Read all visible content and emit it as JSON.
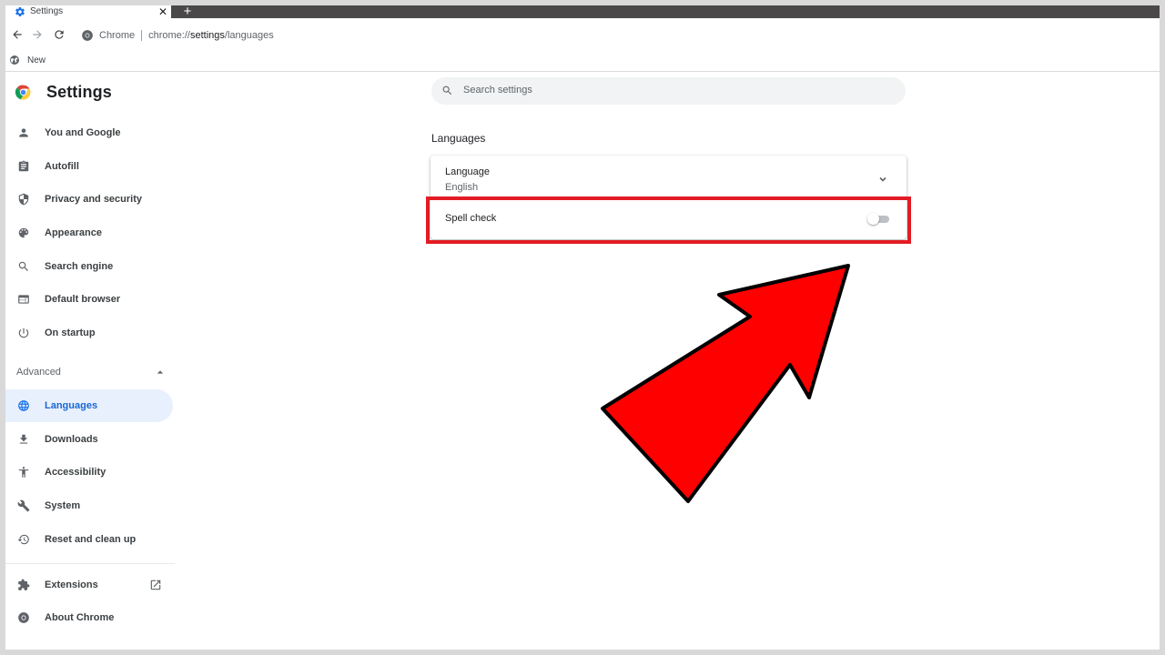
{
  "browser": {
    "tab_title": "Settings",
    "omnibox_chip": "Chrome",
    "url_scheme": "chrome://",
    "url_host": "settings",
    "url_path": "/languages",
    "bookmark_label": "New"
  },
  "sidebar": {
    "title": "Settings",
    "items": [
      {
        "label": "You and Google",
        "icon": "person-icon"
      },
      {
        "label": "Autofill",
        "icon": "clipboard-icon"
      },
      {
        "label": "Privacy and security",
        "icon": "shield-icon"
      },
      {
        "label": "Appearance",
        "icon": "palette-icon"
      },
      {
        "label": "Search engine",
        "icon": "search-icon"
      },
      {
        "label": "Default browser",
        "icon": "browser-window-icon"
      },
      {
        "label": "On startup",
        "icon": "power-icon"
      }
    ],
    "advanced_label": "Advanced",
    "advanced_items": [
      {
        "label": "Languages",
        "icon": "globe-icon",
        "active": true
      },
      {
        "label": "Downloads",
        "icon": "download-icon"
      },
      {
        "label": "Accessibility",
        "icon": "accessibility-icon"
      },
      {
        "label": "System",
        "icon": "wrench-icon"
      },
      {
        "label": "Reset and clean up",
        "icon": "history-icon"
      }
    ],
    "extensions_label": "Extensions",
    "about_label": "About Chrome"
  },
  "main": {
    "search_placeholder": "Search settings",
    "section_title": "Languages",
    "language_row": {
      "title": "Language",
      "value": "English"
    },
    "spell_check": {
      "label": "Spell check",
      "enabled": false
    }
  },
  "colors": {
    "accent": "#1a73e8",
    "highlight_border": "#e31b23",
    "annotation_arrow": "#ff0000",
    "active_item_bg": "#e8f0fe"
  }
}
